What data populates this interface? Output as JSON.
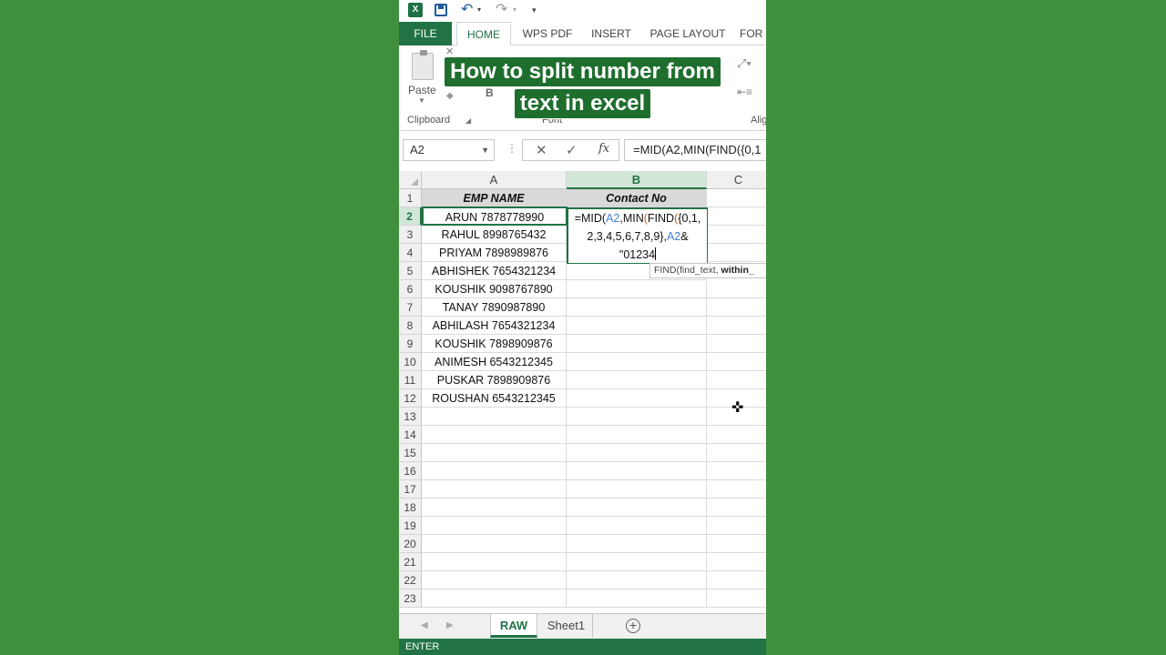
{
  "quick_access": {
    "undo": "↶",
    "redo": "↷",
    "customize": "▾"
  },
  "ribbon_tabs": [
    "FILE",
    "HOME",
    "WPS PDF",
    "INSERT",
    "PAGE LAYOUT",
    "FOR"
  ],
  "ribbon": {
    "paste_label": "Paste",
    "clipboard_label": "Clipboard",
    "font_label": "Font",
    "align_label": "Alig"
  },
  "caption": {
    "line1": "How to split number from",
    "line2": "text in excel"
  },
  "formula_bar": {
    "name_box": "A2",
    "formula": "=MID(A2,MIN(FIND({0,1"
  },
  "columns": [
    "A",
    "B",
    "C"
  ],
  "rows": [
    "1",
    "2",
    "3",
    "4",
    "5",
    "6",
    "7",
    "8",
    "9",
    "10",
    "11",
    "12",
    "13",
    "14",
    "15",
    "16",
    "17",
    "18",
    "19",
    "20",
    "21",
    "22",
    "23"
  ],
  "headers": {
    "a": "EMP NAME",
    "b": "Contact No"
  },
  "employees": [
    "ARUN 7878778990",
    "RAHUL 8998765432",
    "PRIYAM 7898989876",
    "ABHISHEK 7654321234",
    "KOUSHIK 9098767890",
    "TANAY 7890987890",
    "ABHILASH 7654321234",
    "KOUSHIK 7898909876",
    "ANIMESH 6543212345",
    "PUSKAR 7898909876",
    "ROUSHAN 6543212345"
  ],
  "editor": {
    "l1a": "=MID(",
    "l1ref": "A2",
    "l1b": ",MIN",
    "l1p": "(",
    "l1c": "FIND",
    "l1br": "(",
    "l1d": "{0,1,",
    "l2a": "2,3,4,5,6,7,8,9}",
    "l2b": ",",
    "l2ref": "A2",
    "l2c": "&",
    "l3": "\"01234"
  },
  "tooltip": {
    "fn": "FIND(find_text, ",
    "arg": "within_"
  },
  "sheets": [
    "RAW",
    "Sheet1"
  ],
  "status": "ENTER"
}
